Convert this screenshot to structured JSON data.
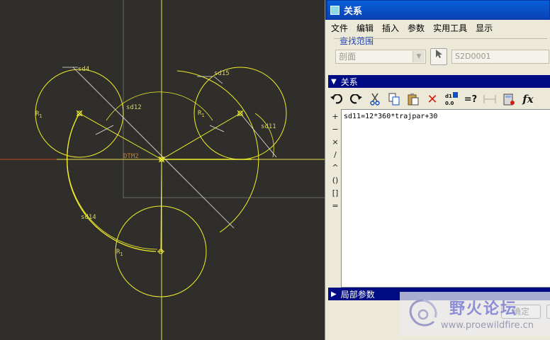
{
  "sketch": {
    "dims": {
      "sd4": "sd4",
      "sd15": "sd15",
      "sd12": "sd12",
      "sd11": "sd11",
      "sd14": "sd14"
    },
    "radius_label": "R",
    "radius_sub": "1",
    "datum_label": "DTM2"
  },
  "dialog": {
    "title": "关系",
    "menu": [
      "文件",
      "编辑",
      "插入",
      "参数",
      "实用工具",
      "显示"
    ],
    "search_scope_label": "查找范围",
    "scope_value": "剖面",
    "object_value": "S2D0001",
    "relations_header": "关系",
    "local_params_header": "局部参数",
    "operators": [
      "+",
      "−",
      "×",
      "/",
      "^",
      "()",
      "[]",
      "="
    ],
    "relation_text": "sd11=12*360*trajpar+30",
    "ok_label": "确定"
  },
  "watermark": {
    "chinese": "野火论坛",
    "url": "www.proewildfire.cn"
  },
  "colors": {
    "sketch_yellow": "#f2ef2c",
    "background": "#2f2e2b",
    "title_blue": "#0a5fd8",
    "section_navy": "#000c84"
  }
}
